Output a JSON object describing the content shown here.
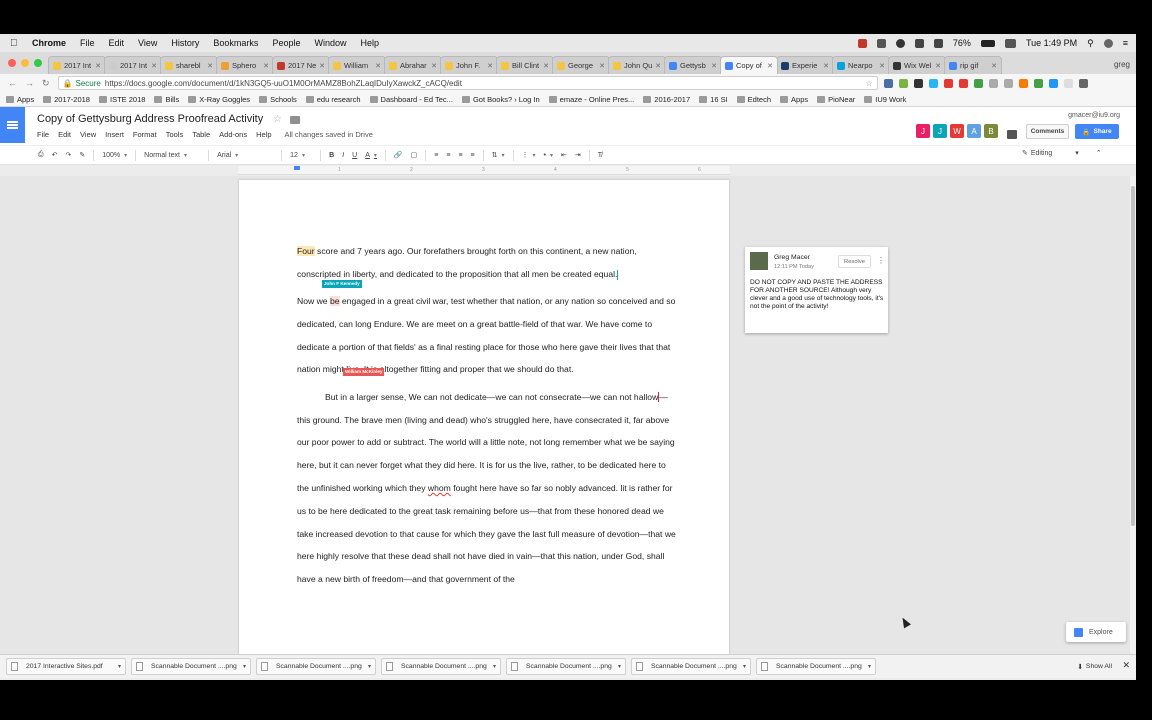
{
  "menubar": {
    "app": "Chrome",
    "items": [
      "File",
      "Edit",
      "View",
      "History",
      "Bookmarks",
      "People",
      "Window",
      "Help"
    ],
    "battery": "76%",
    "clock": "Tue 1:49 PM"
  },
  "tabs": [
    {
      "label": "2017 Int",
      "color": "#f5c542"
    },
    {
      "label": "2017 Int",
      "color": "#cccccc"
    },
    {
      "label": "sharebl",
      "color": "#f5c542"
    },
    {
      "label": "Sphero",
      "color": "#f0a030"
    },
    {
      "label": "2017 Ne",
      "color": "#c0392b"
    },
    {
      "label": "William",
      "color": "#f5c542"
    },
    {
      "label": "Abrahar",
      "color": "#f5c542"
    },
    {
      "label": "John F.",
      "color": "#f5c542"
    },
    {
      "label": "Bill Clint",
      "color": "#f5c542"
    },
    {
      "label": "George",
      "color": "#f5c542"
    },
    {
      "label": "John Qu",
      "color": "#f5c542"
    },
    {
      "label": "Gettysb",
      "color": "#4285f4"
    },
    {
      "label": "Copy of",
      "color": "#4285f4",
      "active": true
    },
    {
      "label": "Experie",
      "color": "#1a3c6b"
    },
    {
      "label": "Nearpo",
      "color": "#0aa3d8"
    },
    {
      "label": "Wix Wel",
      "color": "#333333"
    },
    {
      "label": "rip gif",
      "color": "#4285f4"
    }
  ],
  "profile": "greg",
  "omnibox": {
    "secure": "Secure",
    "url": "https://docs.google.com/document/d/1kN3GQ5-uuO1M0OrMAMZ8BohZLaqIDuIyXawckZ_cACQ/edit"
  },
  "bookmarks": [
    "Apps",
    "2017-2018",
    "ISTE 2018",
    "Bills",
    "X-Ray Goggles",
    "Schools",
    "edu research",
    "Dashboard - Ed Tec...",
    "Got Books? › Log In",
    "emaze - Online Pres...",
    "2016-2017",
    "16 SI",
    "Edtech",
    "Apps",
    "PioNear",
    "IU9 Work"
  ],
  "doc": {
    "title": "Copy of Gettysburg Address Proofread Activity",
    "menu": [
      "File",
      "Edit",
      "View",
      "Insert",
      "Format",
      "Tools",
      "Table",
      "Add-ons",
      "Help"
    ],
    "saved": "All changes saved in Drive",
    "email": "gmacer@iu9.org",
    "collaborators": [
      {
        "initial": "J",
        "color": "#e91e63"
      },
      {
        "initial": "J",
        "color": "#0ba5b8"
      },
      {
        "initial": "W",
        "color": "#e53935"
      },
      {
        "initial": "A",
        "color": "#5fa0e0"
      },
      {
        "initial": "B",
        "color": "#7a8a3a"
      }
    ],
    "comments_label": "Comments",
    "share_label": "Share"
  },
  "toolbar": {
    "zoom": "100%",
    "style": "Normal text",
    "font": "Arial",
    "size": "12",
    "mode": "Editing"
  },
  "ruler_marks": [
    "1",
    "2",
    "3",
    "4",
    "5",
    "6"
  ],
  "body": {
    "p1_a": "Four",
    "p1_b": " score and 7 years ago.  Our  forefathers brought forth on this continent, a new nation, conscripted in liberty, and dedicated to the proposition that all men be created equal.",
    "p2_a": "Now we ",
    "p2_b": "be",
    "p2_c": " engaged in a great civil war, test whether that nation, or any nation so conceived and so dedicated, can long Endure. We are meet on a great battle-field of that war. We have come to dedicate a portion of that fields' as a final resting place for those who here gave their lives that that nation might live. It is altogether fitting and proper that we should do that.",
    "p3_a": "But in a larger sense, We can not dedicate—we can not consecrate—we can not ",
    "p3_b": "hallow",
    "p3_c": "—this ground. The brave men (living and dead) who's struggled here, have consecrated it, far above our poor power to add or subtract. The world will a little note, not long remember what we be saying here, but it can never forget what they did here. It is for us the live, rather, to be dedicated here to the unfinished working which they ",
    "p3_d": "whom",
    "p3_e": " fought here have so far so nobly advanced. lit is rather for us to be here dedicated to the great task remaining before us—that from these honored dead we take increased devotion to that cause for which they gave the last full measure of devotion—that we here highly resolve that these dead shall not have died in vain—that this nation, under God, shall have a new birth of freedom—and that government of the"
  },
  "cursors": {
    "jfk": "John F Kennedy",
    "mck": "William McKinley"
  },
  "comment": {
    "author": "Greg Macer",
    "time": "12:11 PM Today",
    "resolve": "Resolve",
    "text": "DO NOT COPY AND PASTE THE ADDRESS FOR ANOTHER SOURCE! Although very clever and a good use of technology tools, it's not the point of the activity!"
  },
  "explore": "Explore",
  "downloads": [
    "2017 Interactive Sites.pdf",
    "Scannable Document ....png",
    "Scannable Document ....png",
    "Scannable Document ....png",
    "Scannable Document ....png",
    "Scannable Document ....png",
    "Scannable Document ....png"
  ],
  "show_all": "Show All"
}
